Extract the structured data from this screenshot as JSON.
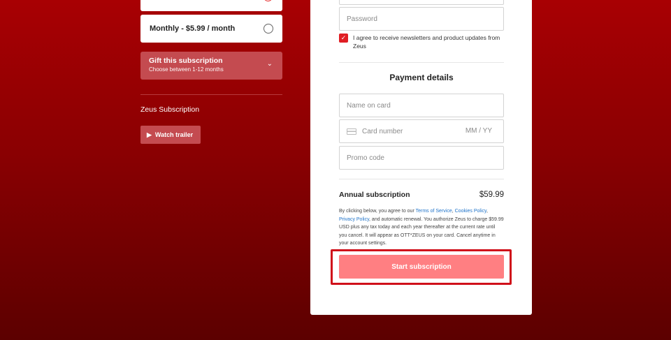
{
  "left": {
    "plan_monthly_label": "Monthly - $5.99 / month",
    "gift": {
      "title": "Gift this subscription",
      "subtitle": "Choose between 1-12 months"
    },
    "subscription_title": "Zeus Subscription",
    "watch_trailer_label": "Watch trailer"
  },
  "form": {
    "password_placeholder": "Password",
    "newsletter_checked": true,
    "newsletter_label": "I agree to receive newsletters and product updates from Zeus",
    "payment_title": "Payment details",
    "name_placeholder": "Name on card",
    "card_placeholder": "Card number",
    "expiry_placeholder": "MM / YY",
    "promo_placeholder": "Promo code",
    "summary_label": "Annual subscription",
    "summary_price": "$59.99",
    "legal": {
      "p1": "By clicking below, you agree to our ",
      "terms": "Terms of Service",
      "comma": ", ",
      "cookies": "Cookies Policy",
      "comma2": ",",
      "privacy": "Privacy Policy",
      "p2": ", and automatic renewal. You authorize Zeus to charge $59.99 USD plus any tax today and each year thereafter at the current rate until you cancel. It will appear as OTT*ZEUS on your card. Cancel anytime in your account settings."
    },
    "submit_label": "Start subscription"
  },
  "colors": {
    "background_top": "#a80003",
    "background_bottom": "#5c0000",
    "accent": "#e01e24",
    "button": "#ff7f82",
    "link": "#1f73c9"
  }
}
